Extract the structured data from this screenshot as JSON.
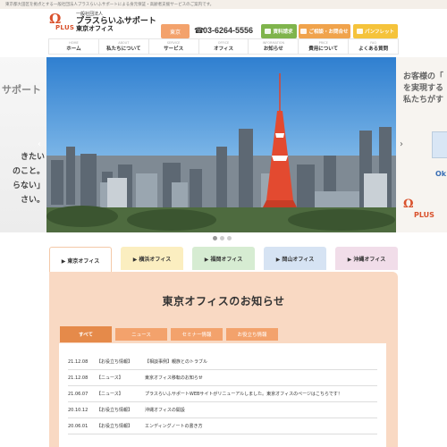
{
  "top_note": "東京都大田区を拠点とする一般社団法人プラスらいふサポートによる身元保証・高齢者支援サービスのご案内です。",
  "header": {
    "logo_mark": "Ω",
    "logo_plus": "PLUS",
    "brand_small": "一般社団法人",
    "brand_name": "プラスらいふサポート",
    "brand_office": "東京オフィス",
    "area_button": "東京",
    "phone_icon": "☎",
    "phone": "03-6264-5556",
    "docs_button": "資料請求",
    "contact_button": "ご相談・お問合せ",
    "pamphlet_button": "パンフレット"
  },
  "nav": {
    "items": [
      {
        "sub": "HOME",
        "label": "ホーム"
      },
      {
        "sub": "ABOUT",
        "label": "私たちについて"
      },
      {
        "sub": "SERVICE",
        "label": "サービス"
      },
      {
        "sub": "OFFICE",
        "label": "オフィス"
      },
      {
        "sub": "INFORMATION",
        "label": "お知らせ"
      },
      {
        "sub": "PRICE",
        "label": "費用について"
      },
      {
        "sub": "FAQ",
        "label": "よくある質問"
      }
    ]
  },
  "hero": {
    "left_heading": "サポート",
    "left_lines": [
      "きたい",
      "のこと。",
      "らない」",
      "さい。"
    ],
    "right_lines": [
      "お客様の「",
      "を実現する",
      "私たちがす"
    ],
    "right_ok": "Ok",
    "right_plus": "Ω",
    "right_plus_text": "PLUS",
    "arrow_left": "‹",
    "arrow_right": "›"
  },
  "office_tabs": [
    {
      "label": "▶ 東京オフィス",
      "color": "#ffffff"
    },
    {
      "label": "▶ 横浜オフィス",
      "color": "#fbeec0"
    },
    {
      "label": "▶ 福岡オフィス",
      "color": "#d6ecd2"
    },
    {
      "label": "▶ 岡山オフィス",
      "color": "#d6e3f3"
    },
    {
      "label": "▶ 沖縄オフィス",
      "color": "#f1dde9"
    }
  ],
  "panel": {
    "title": "東京オフィスのお知らせ",
    "category_tabs": [
      "すべて",
      "ニュース",
      "セミナー情報",
      "お役立ち情報"
    ],
    "news": [
      {
        "date": "21.12.08",
        "category": "【お役立ち情報】",
        "title": "【相談事例】親族とのトラブル"
      },
      {
        "date": "21.12.08",
        "category": "【ニュース】",
        "title": "東京オフィス移転のお知らせ"
      },
      {
        "date": "21.06.07",
        "category": "【ニュース】",
        "title": "プラスらいふサポートWEBサイトがリニューアルしました。東京オフィスのページはこちらです！"
      },
      {
        "date": "20.10.12",
        "category": "【お役立ち情報】",
        "title": "沖縄オフィスの開設"
      },
      {
        "date": "20.06.01",
        "category": "【お役立ち情報】",
        "title": "エンディングノートの書き方"
      }
    ]
  },
  "colors": {
    "accent": "#f3a26c",
    "brand_red": "#d9512c",
    "panel_bg": "#f9d9c3"
  }
}
